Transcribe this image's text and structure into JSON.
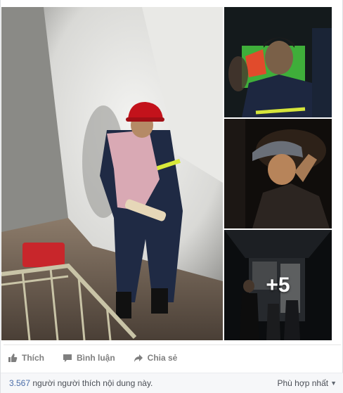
{
  "post": {
    "photos": {
      "more_count": "+5"
    },
    "actions": {
      "like_label": "Thích",
      "comment_label": "Bình luận",
      "share_label": "Chia sẻ"
    },
    "footer": {
      "likes_count": "3.567",
      "likes_text": "người người thích nội dung này.",
      "sort_label": "Phù hợp nhất"
    }
  },
  "icons": {
    "like": "thumbs-up-icon",
    "comment": "speech-bubble-icon",
    "share": "share-arrow-icon",
    "sort": "chevron-down-icon"
  },
  "colors": {
    "link": "#4b6da8",
    "action_text": "#7f7f7f",
    "footer_bg": "#f6f7f9"
  }
}
